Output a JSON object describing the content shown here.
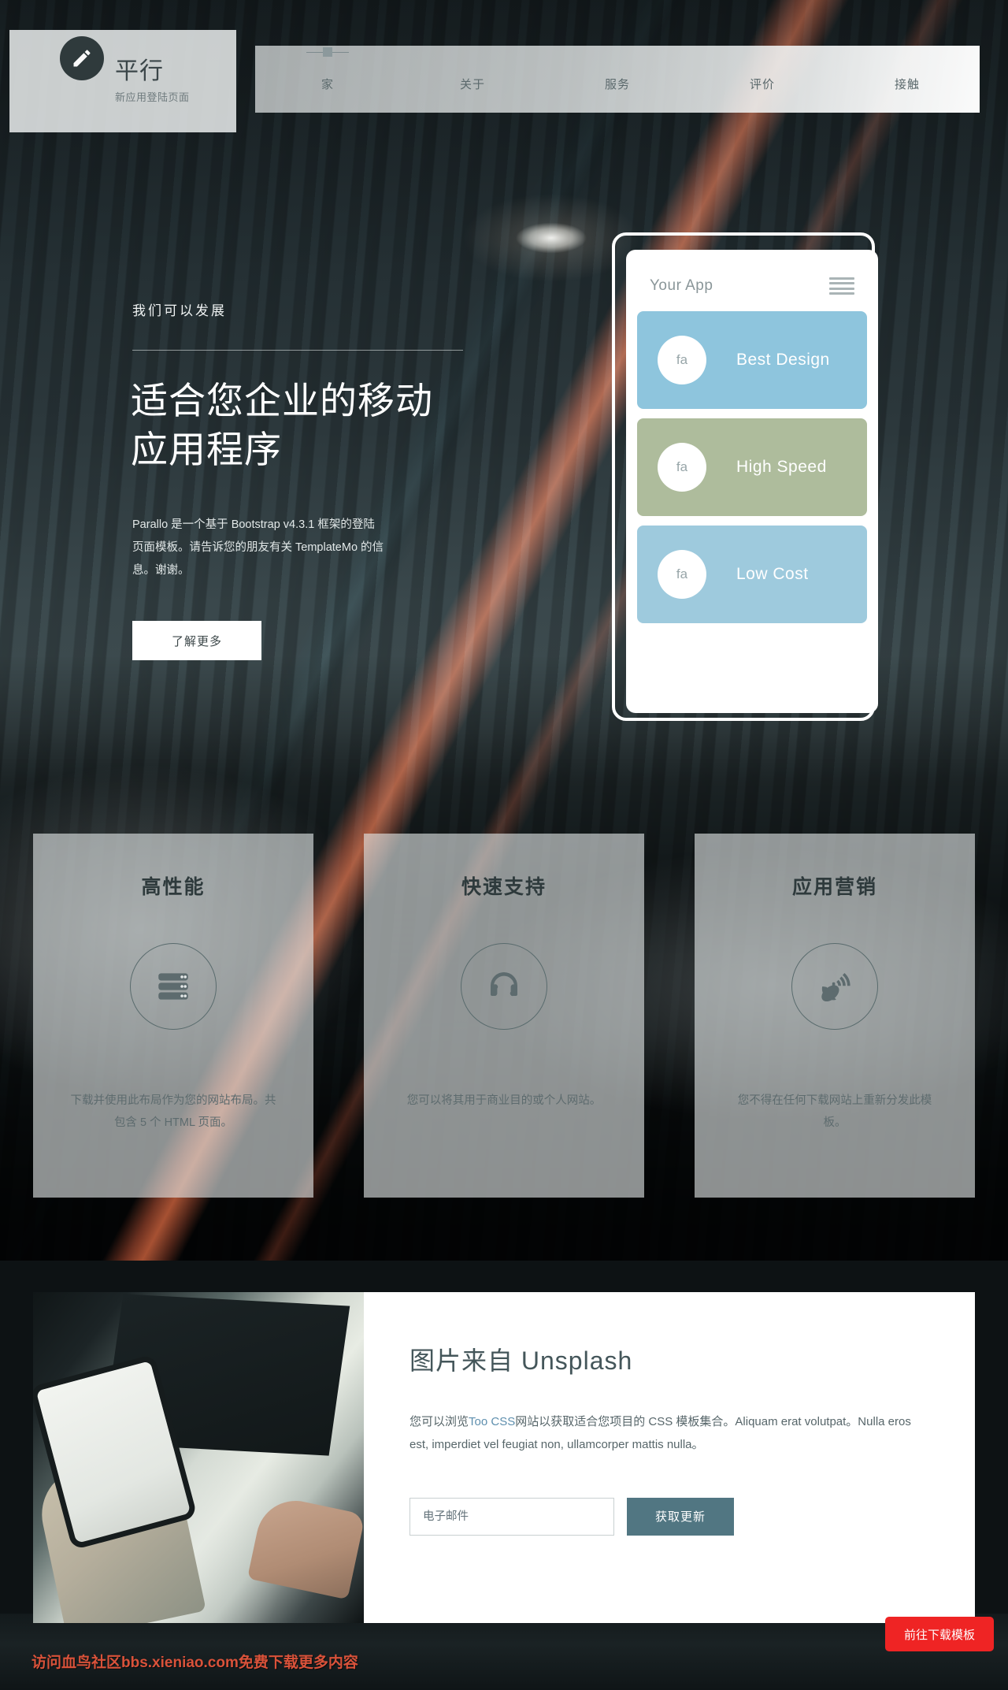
{
  "brand": {
    "title": "平行",
    "subtitle": "新应用登陆页面",
    "logo_icon": "pencil-icon"
  },
  "nav": {
    "items": [
      {
        "label": "家",
        "active": true
      },
      {
        "label": "关于",
        "active": false
      },
      {
        "label": "服务",
        "active": false
      },
      {
        "label": "评价",
        "active": false
      },
      {
        "label": "接触",
        "active": false
      }
    ]
  },
  "hero": {
    "eyebrow": "我们可以发展",
    "heading": "适合您企业的移动应用程序",
    "paragraph": "Parallo 是一个基于 Bootstrap v4.3.1 框架的登陆页面模板。请告诉您的朋友有关 TemplateMo 的信息。谢谢。",
    "cta_label": "了解更多"
  },
  "phone": {
    "app_name": "Your App",
    "menu_icon": "hamburger-icon",
    "cards": [
      {
        "icon_text": "fa",
        "label": "Best Design",
        "color": "#8ec5dd"
      },
      {
        "icon_text": "fa",
        "label": "High Speed",
        "color": "#aebc9c"
      },
      {
        "icon_text": "fa",
        "label": "Low Cost",
        "color": "#9ecadd"
      }
    ]
  },
  "features": [
    {
      "title": "高性能",
      "icon": "server-icon",
      "text": "下载并使用此布局作为您的网站布局。共包含 5 个 HTML 页面。"
    },
    {
      "title": "快速支持",
      "icon": "headphones-icon",
      "text": "您可以将其用于商业目的或个人网站。"
    },
    {
      "title": "应用营销",
      "icon": "satellite-dish-icon",
      "text": "您不得在任何下载网站上重新分发此模板。"
    }
  ],
  "unsplash": {
    "photo_alt": "hand-holding-phone-over-laptop-photo",
    "heading": "图片来自 Unsplash",
    "body_before_link": "您可以浏览",
    "link_text": "Too CSS",
    "body_after_link": "网站以获取适合您项目的 CSS 模板集合。Aliquam erat volutpat。Nulla eros est, imperdiet vel feugiat non, ullamcorper mattis nulla。",
    "email_placeholder": "电子邮件",
    "email_value": "",
    "submit_label": "获取更新"
  },
  "footer": {
    "watermark": "访问血鸟社区bbs.xieniao.com免费下载更多内容",
    "download_button": "前往下载模板"
  },
  "colors": {
    "accent_blue": "#8ec5dd",
    "accent_green": "#aebc9c",
    "accent_blue2": "#9ecadd",
    "submit_teal": "#517682",
    "download_red": "#ef2424",
    "watermark_red": "#d9523a",
    "dark": "#2f3a3c"
  }
}
